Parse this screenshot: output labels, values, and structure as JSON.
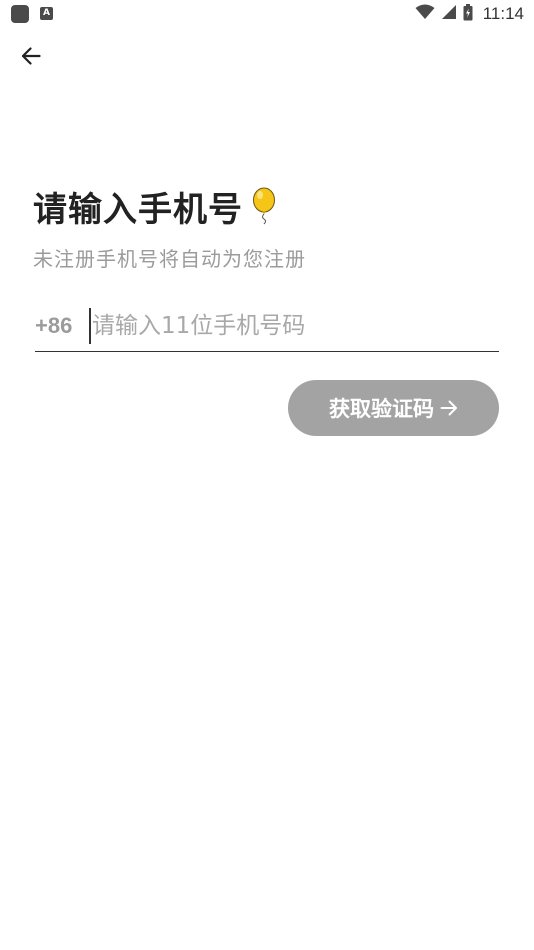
{
  "status_bar": {
    "time": "11:14",
    "a_icon_letter": "A",
    "icons": [
      "app-icon",
      "a-icon",
      "wifi-icon",
      "cell-signal-icon",
      "battery-icon"
    ]
  },
  "nav": {
    "back_icon": "arrow-left-icon"
  },
  "login": {
    "title": "请输入手机号",
    "title_icon": "balloon-icon",
    "subtitle": "未注册手机号将自动为您注册",
    "country_code": "+86",
    "phone_placeholder": "请输入11位手机号码",
    "phone_value": "",
    "submit_label": "获取验证码",
    "submit_icon": "arrow-right-icon"
  },
  "colors": {
    "button_bg": "#a3a3a3",
    "balloon": "#f5c518",
    "muted_text": "#9b9b9b",
    "title_text": "#222222"
  }
}
